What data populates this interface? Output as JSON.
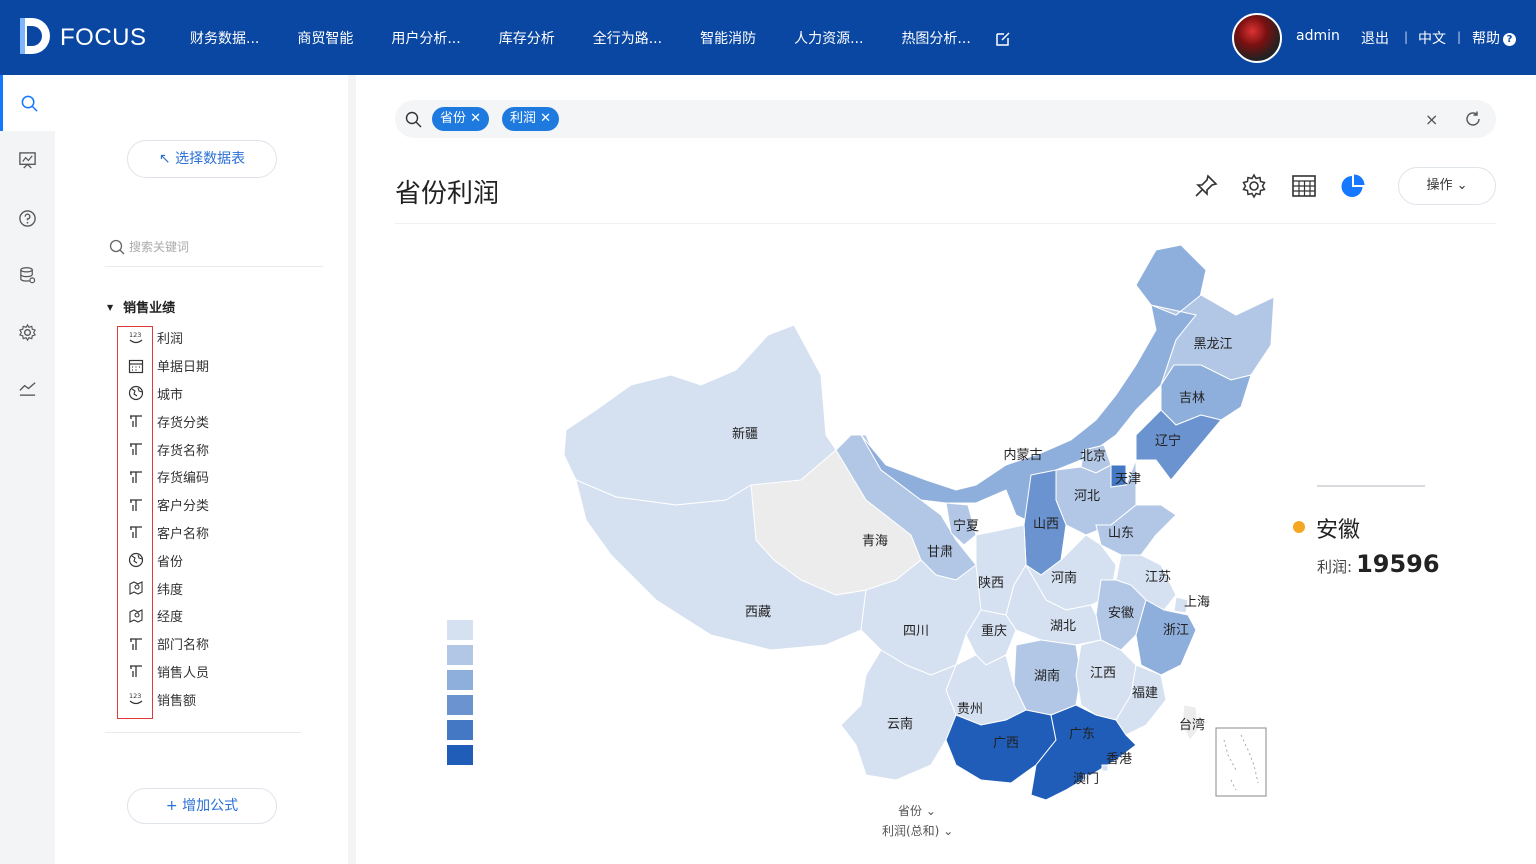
{
  "brand": {
    "name": "FOCUS"
  },
  "nav": {
    "items": [
      "财务数据...",
      "商贸智能",
      "用户分析...",
      "库存分析",
      "全行为路...",
      "智能消防",
      "人力资源...",
      "热图分析..."
    ]
  },
  "user": {
    "name": "admin",
    "logout": "退出",
    "language": "中文",
    "help": "帮助"
  },
  "rail": {
    "icons": [
      "search-icon",
      "dashboard-icon",
      "help-icon",
      "database-icon",
      "settings-icon",
      "trend-icon"
    ]
  },
  "panel": {
    "select_table": "↖ 选择数据表",
    "search_placeholder": "搜索关键词",
    "group": "销售业绩",
    "fields": [
      {
        "label": "利润",
        "icon": "number-icon"
      },
      {
        "label": "单据日期",
        "icon": "calendar-icon"
      },
      {
        "label": "城市",
        "icon": "globe-icon"
      },
      {
        "label": "存货分类",
        "icon": "text-icon"
      },
      {
        "label": "存货名称",
        "icon": "text-icon"
      },
      {
        "label": "存货编码",
        "icon": "text-icon"
      },
      {
        "label": "客户分类",
        "icon": "text-icon"
      },
      {
        "label": "客户名称",
        "icon": "text-icon"
      },
      {
        "label": "省份",
        "icon": "globe-icon"
      },
      {
        "label": "纬度",
        "icon": "map-pin-icon"
      },
      {
        "label": "经度",
        "icon": "map-pin-icon"
      },
      {
        "label": "部门名称",
        "icon": "text-icon"
      },
      {
        "label": "销售人员",
        "icon": "text-icon"
      },
      {
        "label": "销售额",
        "icon": "number-icon"
      }
    ],
    "add_formula": "+ 增加公式"
  },
  "query": {
    "chips": [
      "省份",
      "利润"
    ],
    "clear": "×"
  },
  "chart": {
    "title": "省份利润",
    "operations": "操作",
    "x_selector": "省份",
    "y_selector": "利润(总和)"
  },
  "tooltip": {
    "province": "安徽",
    "metric_label": "利润:",
    "metric_value": "19596"
  },
  "colors": {
    "brand": "#0a47a3",
    "accent": "#1f7ae0",
    "legend": [
      "#d5e0f1",
      "#b2c7e6",
      "#8eaedb",
      "#6a93cf",
      "#4478c4",
      "#1f5db8"
    ],
    "no_data": "#ececec"
  },
  "chart_data": {
    "type": "choropleth-map",
    "region": "China provinces",
    "metric": "利润",
    "values": [
      {
        "name": "新疆",
        "level": 1
      },
      {
        "name": "西藏",
        "level": 1
      },
      {
        "name": "青海",
        "level": 0
      },
      {
        "name": "甘肃",
        "level": 2
      },
      {
        "name": "宁夏",
        "level": 2
      },
      {
        "name": "内蒙古",
        "level": 3
      },
      {
        "name": "黑龙江",
        "level": 2
      },
      {
        "name": "吉林",
        "level": 3
      },
      {
        "name": "辽宁",
        "level": 4
      },
      {
        "name": "北京",
        "level": 2
      },
      {
        "name": "天津",
        "level": 5
      },
      {
        "name": "河北",
        "level": 2
      },
      {
        "name": "山西",
        "level": 4
      },
      {
        "name": "山东",
        "level": 2
      },
      {
        "name": "陕西",
        "level": 1
      },
      {
        "name": "河南",
        "level": 1
      },
      {
        "name": "江苏",
        "level": 1
      },
      {
        "name": "安徽",
        "level": 2,
        "value": 19596
      },
      {
        "name": "上海",
        "level": 1
      },
      {
        "name": "浙江",
        "level": 3
      },
      {
        "name": "四川",
        "level": 1
      },
      {
        "name": "重庆",
        "level": 1
      },
      {
        "name": "湖北",
        "level": 1
      },
      {
        "name": "湖南",
        "level": 2
      },
      {
        "name": "江西",
        "level": 1
      },
      {
        "name": "福建",
        "level": 1
      },
      {
        "name": "云南",
        "level": 1
      },
      {
        "name": "贵州",
        "level": 1
      },
      {
        "name": "广西",
        "level": 6
      },
      {
        "name": "广东",
        "level": 6
      },
      {
        "name": "香港",
        "level": 1
      },
      {
        "name": "澳门",
        "level": 1
      },
      {
        "name": "台湾",
        "level": 0
      }
    ]
  }
}
